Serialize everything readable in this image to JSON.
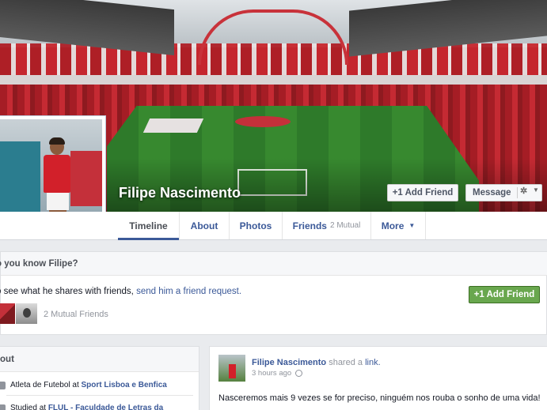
{
  "profile": {
    "name": "Filipe Nascimento",
    "cover_icon": "stadium-cover-photo",
    "avatar_icon": "profile-picture"
  },
  "actions": {
    "add_friend_label": "+1 Add Friend",
    "message_label": "Message",
    "gear_icon": "gear-icon",
    "caret_icon": "caret-down-icon"
  },
  "tabs": [
    {
      "label": "Timeline",
      "active": true
    },
    {
      "label": "About"
    },
    {
      "label": "Photos"
    },
    {
      "label": "Friends",
      "extra": "2 Mutual"
    },
    {
      "label": "More",
      "caret": "▼"
    }
  ],
  "know_prompt": {
    "heading": "o you know Filipe?",
    "text_before": "o see what he shares with friends, ",
    "link_text": "send him a friend request.",
    "add_friend_label": "+1 Add Friend",
    "mutual_friends": "2 Mutual Friends"
  },
  "about": {
    "heading": "bout",
    "items": [
      {
        "text": "Atleta de Futebol at ",
        "link": "Sport Lisboa e Benfica"
      },
      {
        "text": "Studied at ",
        "link": "FLUL - Faculdade de Letras da"
      }
    ]
  },
  "post": {
    "author": "Filipe Nascimento",
    "action_text": " shared a ",
    "link_text": "link.",
    "time": "3 hours ago",
    "body": "Nasceremos mais 9 vezes se for preciso, ninguém nos rouba o sonho de uma vida!"
  },
  "colors": {
    "brand": "#3b5998",
    "green_button": "#69a74e",
    "benfica_red": "#c4303a"
  }
}
